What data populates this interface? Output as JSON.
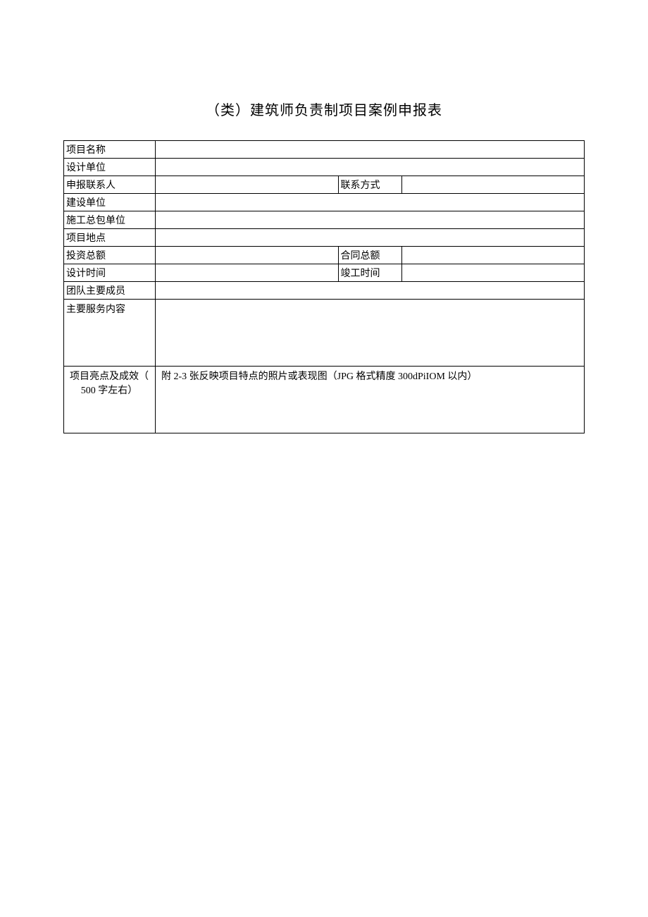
{
  "title": "（类）建筑师负责制项目案例申报表",
  "labels": {
    "project_name": "项目名称",
    "design_unit": "设计单位",
    "applicant": "申报联系人",
    "contact_method": "联系方式",
    "construction_unit": "建设单位",
    "general_contractor": "施工总包单位",
    "project_location": "项目地点",
    "total_investment": "投资总额",
    "contract_total": "合同总额",
    "design_time": "设计时间",
    "completion_time": "竣工时间",
    "team_members": "团队主要成员",
    "service_content": "主要服务内容",
    "highlights_line1": "项目亮点及成效（",
    "highlights_line2": "500 字左右）"
  },
  "values": {
    "project_name": "",
    "design_unit": "",
    "applicant": "",
    "contact_method": "",
    "construction_unit": "",
    "general_contractor": "",
    "project_location": "",
    "total_investment": "",
    "contract_total": "",
    "design_time": "",
    "completion_time": "",
    "team_members": "",
    "service_content": "",
    "highlights": "附 2-3 张反映项目特点的照片或表现图（JPG 格式精度 300dPiIOM 以内）"
  }
}
